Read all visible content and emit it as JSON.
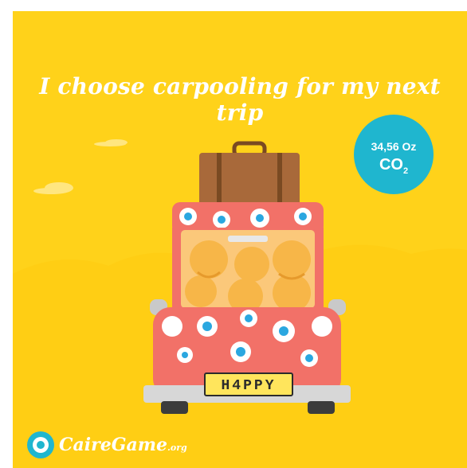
{
  "headline": "I choose carpooling for my next trip",
  "co2_badge": {
    "amount": "34,56 Oz",
    "unit": "CO",
    "subscript": "2"
  },
  "license_plate": "H4PPY",
  "logo": {
    "name": "CaireGame",
    "suffix": ".org"
  },
  "colors": {
    "background": "#FFD21A",
    "badge": "#1FB6CF",
    "car_body": "#F27168",
    "suitcase": "#A8693A",
    "flower_petals": "#FFFFFF",
    "flower_center": "#2AA7E0"
  },
  "icons": [
    "co2-badge",
    "suitcase-icon",
    "car-illustration",
    "passenger-smiley-icon",
    "cloud-icon",
    "cairegame-logo-icon"
  ]
}
